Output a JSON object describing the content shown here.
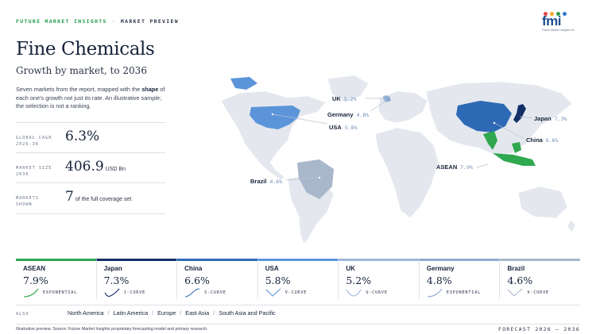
{
  "header": {
    "brand": "FUTURE MARKET INSIGHTS",
    "separator": "·",
    "section": "MARKET PREVIEW"
  },
  "logo": {
    "word": "fmi",
    "subtitle": "Future Market Insights Inc.",
    "dot_colors": [
      "#e0454c",
      "#f5a623",
      "#2e9b4e",
      "#2f79c8"
    ]
  },
  "title": "Fine Chemicals",
  "subtitle": "Growth by market, to 2036",
  "description": {
    "before": "Seven markets from the report, mapped with the ",
    "bold": "shape",
    "after": " of each one's growth not just its rate. An illustrative sample; the selection is not a ranking."
  },
  "stats": [
    {
      "label_line1": "GLOBAL CAGR",
      "label_line2": "2026-36",
      "value": "6.3%",
      "unit": ""
    },
    {
      "label_line1": "MARKET SIZE",
      "label_line2": "2036",
      "value": "406.9",
      "unit": "USD Bn"
    },
    {
      "label_line1": "MARKETS",
      "label_line2": "SHOWN",
      "value": "7",
      "unit": "of the full coverage set"
    }
  ],
  "chart_data": {
    "type": "choropleth",
    "title": "Fine Chemicals",
    "subtitle": "Growth by market, to 2036",
    "unit": "CAGR %",
    "markets": [
      {
        "name": "ASEAN",
        "value": 7.9,
        "rate": "7.9%",
        "shape": "EXPONENTIAL",
        "color": "#2fa84f"
      },
      {
        "name": "Japan",
        "value": 7.3,
        "rate": "7.3%",
        "shape": "J-CURVE",
        "color": "#142f66"
      },
      {
        "name": "China",
        "value": 6.6,
        "rate": "6.6%",
        "shape": "S-CURVE",
        "color": "#2e69b5"
      },
      {
        "name": "USA",
        "value": 5.8,
        "rate": "5.8%",
        "shape": "V-CURVE",
        "color": "#5b94d9"
      },
      {
        "name": "UK",
        "value": 5.2,
        "rate": "5.2%",
        "shape": "U-CURVE",
        "color": "#9db8dc"
      },
      {
        "name": "Germany",
        "value": 4.8,
        "rate": "4.8%",
        "shape": "EXPONENTIAL",
        "color": "#8faad2"
      },
      {
        "name": "Brazil",
        "value": 4.6,
        "rate": "4.6%",
        "shape": "V-CURVE",
        "color": "#a9b7cb"
      }
    ]
  },
  "also": {
    "label": "ALSO",
    "regions": [
      "North America",
      "Latin America",
      "Europe",
      "East Asia",
      "South Asia and Pacific"
    ]
  },
  "footer": {
    "source": "Illustrative preview. Source: Future Market Insights proprietary forecasting model and primary research.",
    "forecast": "FORECAST 2026 – 2036"
  },
  "colors": {
    "land": "#e4e8ee",
    "rate_label": "#6f8bb4",
    "leader_line": "#b9c2d0"
  }
}
